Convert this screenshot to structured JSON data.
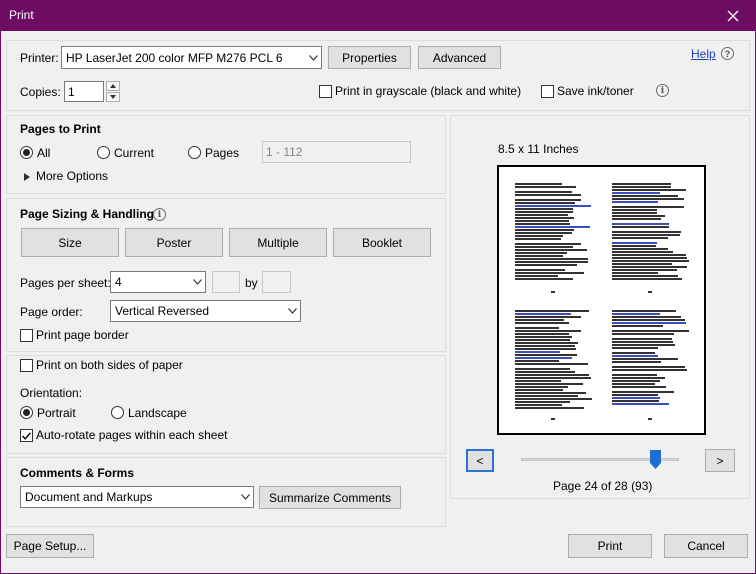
{
  "window": {
    "title": "Print",
    "close_icon": "close-icon"
  },
  "header": {
    "printer_label": "Printer:",
    "printer_value": "HP LaserJet 200 color MFP M276 PCL 6",
    "properties_label": "Properties",
    "advanced_label": "Advanced",
    "help_label": "Help",
    "copies_label": "Copies:",
    "copies_value": "1",
    "grayscale_label": "Print in grayscale (black and white)",
    "grayscale_checked": false,
    "save_ink_label": "Save ink/toner",
    "save_ink_checked": false
  },
  "pages_to_print": {
    "title": "Pages to Print",
    "all_label": "All",
    "current_label": "Current",
    "pages_label": "Pages",
    "pages_placeholder": "1 - 112",
    "selected": "All",
    "more_options_label": "More Options"
  },
  "sizing": {
    "title": "Page Sizing & Handling",
    "buttons": [
      "Size",
      "Poster",
      "Multiple",
      "Booklet"
    ],
    "pages_per_sheet_label": "Pages per sheet:",
    "pages_per_sheet_value": "4",
    "by_label": "by",
    "page_order_label": "Page order:",
    "page_order_value": "Vertical Reversed",
    "print_border_label": "Print page border",
    "print_border_checked": false
  },
  "duplex": {
    "both_sides_label": "Print on both sides of paper",
    "both_sides_checked": false,
    "orientation_label": "Orientation:",
    "portrait_label": "Portrait",
    "landscape_label": "Landscape",
    "selected": "Portrait",
    "autorotate_label": "Auto-rotate pages within each sheet",
    "autorotate_checked": true
  },
  "comments": {
    "title": "Comments & Forms",
    "value": "Document and Markups",
    "summarize_label": "Summarize Comments"
  },
  "preview": {
    "paper_size": "8.5 x 11 Inches",
    "page_info": "Page 24 of 28 (93)",
    "current_page": 24,
    "total_pages": 28,
    "prev_label": "<",
    "next_label": ">"
  },
  "footer": {
    "page_setup_label": "Page Setup...",
    "print_label": "Print",
    "cancel_label": "Cancel"
  },
  "colors": {
    "titlebar": "#6e0c64",
    "link": "#1a45b8",
    "slider": "#1e6fd0"
  }
}
